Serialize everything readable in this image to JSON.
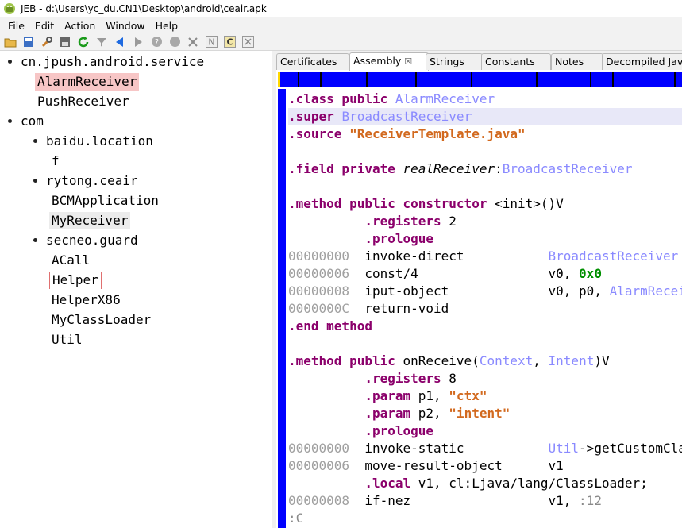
{
  "titlebar": {
    "title": "JEB - d:\\Users\\yc_du.CN1\\Desktop\\android\\ceair.apk"
  },
  "menu": {
    "items": [
      "File",
      "Edit",
      "Action",
      "Window",
      "Help"
    ]
  },
  "toolbar": {
    "icons": [
      "open-folder-icon",
      "save-icon",
      "wrench-icon",
      "floppy-icon",
      "refresh-icon",
      "filter-icon",
      "back-icon",
      "forward-icon",
      "help-icon",
      "info-icon",
      "close-icon",
      "n-icon",
      "c-icon",
      "x-box-icon"
    ],
    "labels": {
      "n": "N",
      "c": "C"
    }
  },
  "tree": {
    "items": [
      {
        "label": "cn.jpush.android.service",
        "level": 0,
        "bullet": true,
        "state": ""
      },
      {
        "label": "AlarmReceiver",
        "level": 1,
        "bullet": false,
        "state": "selected"
      },
      {
        "label": "PushReceiver",
        "level": 1,
        "bullet": false,
        "state": ""
      },
      {
        "label": "com",
        "level": 0,
        "bullet": true,
        "state": ""
      },
      {
        "label": "baidu.location",
        "level": 1,
        "bullet": true,
        "state": ""
      },
      {
        "label": "f",
        "level": 2,
        "bullet": false,
        "state": ""
      },
      {
        "label": "rytong.ceair",
        "level": 1,
        "bullet": true,
        "state": ""
      },
      {
        "label": "BCMApplication",
        "level": 2,
        "bullet": false,
        "state": ""
      },
      {
        "label": "MyReceiver",
        "level": 2,
        "bullet": false,
        "state": "hovered"
      },
      {
        "label": "secneo.guard",
        "level": 1,
        "bullet": true,
        "state": ""
      },
      {
        "label": "ACall",
        "level": 2,
        "bullet": false,
        "state": ""
      },
      {
        "label": "Helper",
        "level": 2,
        "bullet": false,
        "state": "focused"
      },
      {
        "label": "HelperX86",
        "level": 2,
        "bullet": false,
        "state": ""
      },
      {
        "label": "MyClassLoader",
        "level": 2,
        "bullet": false,
        "state": ""
      },
      {
        "label": "Util",
        "level": 2,
        "bullet": false,
        "state": ""
      }
    ]
  },
  "tabs": [
    {
      "label": "Certificates",
      "active": false,
      "close": ""
    },
    {
      "label": "Assembly",
      "active": true,
      "close": "☒"
    },
    {
      "label": "Strings",
      "active": false,
      "close": ""
    },
    {
      "label": "Constants",
      "active": false,
      "close": ""
    },
    {
      "label": "Notes",
      "active": false,
      "close": ""
    },
    {
      "label": "Decompiled Java",
      "active": false,
      "close": ""
    }
  ],
  "colors": {
    "accent_blue": "#0000ff",
    "selection_pink": "#f7c6c6",
    "keyword": "#8b006b",
    "type": "#8a8aff",
    "string": "#d2691e",
    "hex": "#009000"
  },
  "code": {
    "lines": [
      {
        "current": false,
        "tokens": [
          [
            ".class public",
            "kw"
          ],
          [
            " ",
            "plain"
          ],
          [
            "AlarmReceiver",
            "typ"
          ]
        ]
      },
      {
        "current": true,
        "tokens": [
          [
            ".super",
            "kw"
          ],
          [
            " ",
            "plain"
          ],
          [
            "BroadcastReceiver",
            "typ"
          ]
        ]
      },
      {
        "current": false,
        "tokens": [
          [
            ".source",
            "kw"
          ],
          [
            " ",
            "plain"
          ],
          [
            "\"ReceiverTemplate.java\"",
            "str"
          ]
        ]
      },
      {
        "current": false,
        "tokens": []
      },
      {
        "current": false,
        "tokens": [
          [
            ".field private",
            "kw"
          ],
          [
            " ",
            "plain"
          ],
          [
            "realReceiver",
            "fld"
          ],
          [
            ":",
            "plain"
          ],
          [
            "BroadcastReceiver",
            "typ"
          ]
        ]
      },
      {
        "current": false,
        "tokens": []
      },
      {
        "current": false,
        "tokens": [
          [
            ".method public constructor",
            "kw"
          ],
          [
            " <init>()V",
            "plain"
          ]
        ]
      },
      {
        "current": false,
        "tokens": [
          [
            "          ",
            "plain"
          ],
          [
            ".registers",
            "dir"
          ],
          [
            " 2",
            "plain"
          ]
        ]
      },
      {
        "current": false,
        "tokens": [
          [
            "          ",
            "plain"
          ],
          [
            ".prologue",
            "dir"
          ]
        ]
      },
      {
        "current": false,
        "tokens": [
          [
            "00000000",
            "addr"
          ],
          [
            "  invoke-direct           ",
            "plain"
          ],
          [
            "BroadcastReceiver",
            "typ"
          ]
        ]
      },
      {
        "current": false,
        "tokens": [
          [
            "00000006",
            "addr"
          ],
          [
            "  const/4                 v0, ",
            "plain"
          ],
          [
            "0x0",
            "hex"
          ]
        ]
      },
      {
        "current": false,
        "tokens": [
          [
            "00000008",
            "addr"
          ],
          [
            "  iput-object             v0, p0, ",
            "plain"
          ],
          [
            "AlarmReceiver",
            "typ"
          ]
        ]
      },
      {
        "current": false,
        "tokens": [
          [
            "0000000C",
            "addr"
          ],
          [
            "  return-void",
            "plain"
          ]
        ]
      },
      {
        "current": false,
        "tokens": [
          [
            ".end method",
            "kw"
          ]
        ]
      },
      {
        "current": false,
        "tokens": []
      },
      {
        "current": false,
        "tokens": [
          [
            ".method public",
            "kw"
          ],
          [
            " onReceive(",
            "plain"
          ],
          [
            "Context",
            "typ"
          ],
          [
            ", ",
            "plain"
          ],
          [
            "Intent",
            "typ"
          ],
          [
            ")V",
            "plain"
          ]
        ]
      },
      {
        "current": false,
        "tokens": [
          [
            "          ",
            "plain"
          ],
          [
            ".registers",
            "dir"
          ],
          [
            " 8",
            "plain"
          ]
        ]
      },
      {
        "current": false,
        "tokens": [
          [
            "          ",
            "plain"
          ],
          [
            ".param",
            "dir"
          ],
          [
            " p1, ",
            "plain"
          ],
          [
            "\"ctx\"",
            "str"
          ]
        ]
      },
      {
        "current": false,
        "tokens": [
          [
            "          ",
            "plain"
          ],
          [
            ".param",
            "dir"
          ],
          [
            " p2, ",
            "plain"
          ],
          [
            "\"intent\"",
            "str"
          ]
        ]
      },
      {
        "current": false,
        "tokens": [
          [
            "          ",
            "plain"
          ],
          [
            ".prologue",
            "dir"
          ]
        ]
      },
      {
        "current": false,
        "tokens": [
          [
            "00000000",
            "addr"
          ],
          [
            "  invoke-static           ",
            "plain"
          ],
          [
            "Util",
            "typ"
          ],
          [
            "->getCustomClassLoader",
            "plain"
          ]
        ]
      },
      {
        "current": false,
        "tokens": [
          [
            "00000006",
            "addr"
          ],
          [
            "  move-result-object      v1",
            "plain"
          ]
        ]
      },
      {
        "current": false,
        "tokens": [
          [
            "          ",
            "plain"
          ],
          [
            ".local",
            "dir"
          ],
          [
            " v1, cl:Ljava/lang/ClassLoader;",
            "plain"
          ]
        ]
      },
      {
        "current": false,
        "tokens": [
          [
            "00000008",
            "addr"
          ],
          [
            "  if-nez                  v1, ",
            "plain"
          ],
          [
            ":12",
            "lbl"
          ]
        ]
      },
      {
        "current": false,
        "tokens": [
          [
            ":C",
            "lbl"
          ]
        ]
      }
    ]
  }
}
